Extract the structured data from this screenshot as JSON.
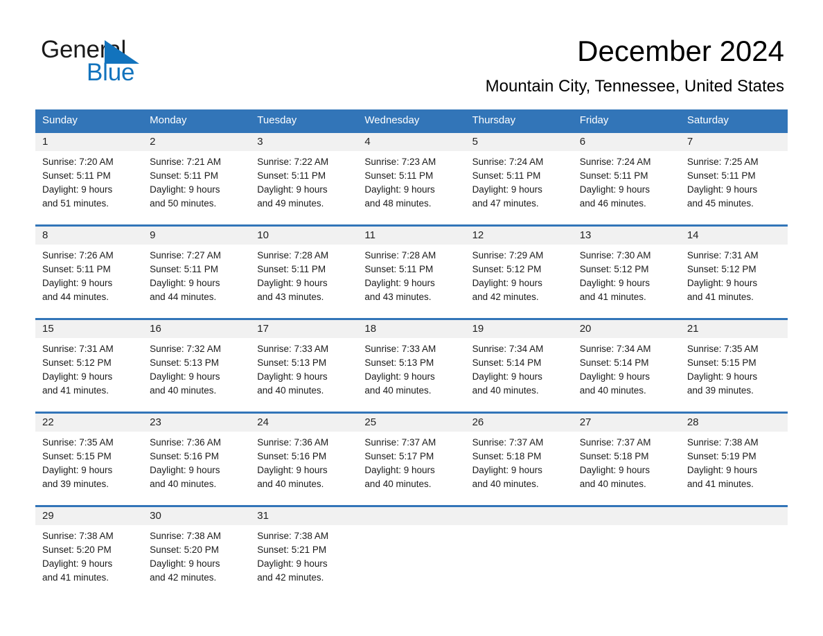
{
  "brand": {
    "name_top": "General",
    "name_bottom": "Blue",
    "accent_color": "#1273bd",
    "header_color": "#3275b8",
    "day_band_color": "#f1f1f1"
  },
  "header": {
    "title": "December 2024",
    "location": "Mountain City, Tennessee, United States"
  },
  "weekdays": [
    "Sunday",
    "Monday",
    "Tuesday",
    "Wednesday",
    "Thursday",
    "Friday",
    "Saturday"
  ],
  "weeks": [
    [
      {
        "day": "1",
        "sunrise": "Sunrise: 7:20 AM",
        "sunset": "Sunset: 5:11 PM",
        "daylight_1": "Daylight: 9 hours",
        "daylight_2": "and 51 minutes."
      },
      {
        "day": "2",
        "sunrise": "Sunrise: 7:21 AM",
        "sunset": "Sunset: 5:11 PM",
        "daylight_1": "Daylight: 9 hours",
        "daylight_2": "and 50 minutes."
      },
      {
        "day": "3",
        "sunrise": "Sunrise: 7:22 AM",
        "sunset": "Sunset: 5:11 PM",
        "daylight_1": "Daylight: 9 hours",
        "daylight_2": "and 49 minutes."
      },
      {
        "day": "4",
        "sunrise": "Sunrise: 7:23 AM",
        "sunset": "Sunset: 5:11 PM",
        "daylight_1": "Daylight: 9 hours",
        "daylight_2": "and 48 minutes."
      },
      {
        "day": "5",
        "sunrise": "Sunrise: 7:24 AM",
        "sunset": "Sunset: 5:11 PM",
        "daylight_1": "Daylight: 9 hours",
        "daylight_2": "and 47 minutes."
      },
      {
        "day": "6",
        "sunrise": "Sunrise: 7:24 AM",
        "sunset": "Sunset: 5:11 PM",
        "daylight_1": "Daylight: 9 hours",
        "daylight_2": "and 46 minutes."
      },
      {
        "day": "7",
        "sunrise": "Sunrise: 7:25 AM",
        "sunset": "Sunset: 5:11 PM",
        "daylight_1": "Daylight: 9 hours",
        "daylight_2": "and 45 minutes."
      }
    ],
    [
      {
        "day": "8",
        "sunrise": "Sunrise: 7:26 AM",
        "sunset": "Sunset: 5:11 PM",
        "daylight_1": "Daylight: 9 hours",
        "daylight_2": "and 44 minutes."
      },
      {
        "day": "9",
        "sunrise": "Sunrise: 7:27 AM",
        "sunset": "Sunset: 5:11 PM",
        "daylight_1": "Daylight: 9 hours",
        "daylight_2": "and 44 minutes."
      },
      {
        "day": "10",
        "sunrise": "Sunrise: 7:28 AM",
        "sunset": "Sunset: 5:11 PM",
        "daylight_1": "Daylight: 9 hours",
        "daylight_2": "and 43 minutes."
      },
      {
        "day": "11",
        "sunrise": "Sunrise: 7:28 AM",
        "sunset": "Sunset: 5:11 PM",
        "daylight_1": "Daylight: 9 hours",
        "daylight_2": "and 43 minutes."
      },
      {
        "day": "12",
        "sunrise": "Sunrise: 7:29 AM",
        "sunset": "Sunset: 5:12 PM",
        "daylight_1": "Daylight: 9 hours",
        "daylight_2": "and 42 minutes."
      },
      {
        "day": "13",
        "sunrise": "Sunrise: 7:30 AM",
        "sunset": "Sunset: 5:12 PM",
        "daylight_1": "Daylight: 9 hours",
        "daylight_2": "and 41 minutes."
      },
      {
        "day": "14",
        "sunrise": "Sunrise: 7:31 AM",
        "sunset": "Sunset: 5:12 PM",
        "daylight_1": "Daylight: 9 hours",
        "daylight_2": "and 41 minutes."
      }
    ],
    [
      {
        "day": "15",
        "sunrise": "Sunrise: 7:31 AM",
        "sunset": "Sunset: 5:12 PM",
        "daylight_1": "Daylight: 9 hours",
        "daylight_2": "and 41 minutes."
      },
      {
        "day": "16",
        "sunrise": "Sunrise: 7:32 AM",
        "sunset": "Sunset: 5:13 PM",
        "daylight_1": "Daylight: 9 hours",
        "daylight_2": "and 40 minutes."
      },
      {
        "day": "17",
        "sunrise": "Sunrise: 7:33 AM",
        "sunset": "Sunset: 5:13 PM",
        "daylight_1": "Daylight: 9 hours",
        "daylight_2": "and 40 minutes."
      },
      {
        "day": "18",
        "sunrise": "Sunrise: 7:33 AM",
        "sunset": "Sunset: 5:13 PM",
        "daylight_1": "Daylight: 9 hours",
        "daylight_2": "and 40 minutes."
      },
      {
        "day": "19",
        "sunrise": "Sunrise: 7:34 AM",
        "sunset": "Sunset: 5:14 PM",
        "daylight_1": "Daylight: 9 hours",
        "daylight_2": "and 40 minutes."
      },
      {
        "day": "20",
        "sunrise": "Sunrise: 7:34 AM",
        "sunset": "Sunset: 5:14 PM",
        "daylight_1": "Daylight: 9 hours",
        "daylight_2": "and 40 minutes."
      },
      {
        "day": "21",
        "sunrise": "Sunrise: 7:35 AM",
        "sunset": "Sunset: 5:15 PM",
        "daylight_1": "Daylight: 9 hours",
        "daylight_2": "and 39 minutes."
      }
    ],
    [
      {
        "day": "22",
        "sunrise": "Sunrise: 7:35 AM",
        "sunset": "Sunset: 5:15 PM",
        "daylight_1": "Daylight: 9 hours",
        "daylight_2": "and 39 minutes."
      },
      {
        "day": "23",
        "sunrise": "Sunrise: 7:36 AM",
        "sunset": "Sunset: 5:16 PM",
        "daylight_1": "Daylight: 9 hours",
        "daylight_2": "and 40 minutes."
      },
      {
        "day": "24",
        "sunrise": "Sunrise: 7:36 AM",
        "sunset": "Sunset: 5:16 PM",
        "daylight_1": "Daylight: 9 hours",
        "daylight_2": "and 40 minutes."
      },
      {
        "day": "25",
        "sunrise": "Sunrise: 7:37 AM",
        "sunset": "Sunset: 5:17 PM",
        "daylight_1": "Daylight: 9 hours",
        "daylight_2": "and 40 minutes."
      },
      {
        "day": "26",
        "sunrise": "Sunrise: 7:37 AM",
        "sunset": "Sunset: 5:18 PM",
        "daylight_1": "Daylight: 9 hours",
        "daylight_2": "and 40 minutes."
      },
      {
        "day": "27",
        "sunrise": "Sunrise: 7:37 AM",
        "sunset": "Sunset: 5:18 PM",
        "daylight_1": "Daylight: 9 hours",
        "daylight_2": "and 40 minutes."
      },
      {
        "day": "28",
        "sunrise": "Sunrise: 7:38 AM",
        "sunset": "Sunset: 5:19 PM",
        "daylight_1": "Daylight: 9 hours",
        "daylight_2": "and 41 minutes."
      }
    ],
    [
      {
        "day": "29",
        "sunrise": "Sunrise: 7:38 AM",
        "sunset": "Sunset: 5:20 PM",
        "daylight_1": "Daylight: 9 hours",
        "daylight_2": "and 41 minutes."
      },
      {
        "day": "30",
        "sunrise": "Sunrise: 7:38 AM",
        "sunset": "Sunset: 5:20 PM",
        "daylight_1": "Daylight: 9 hours",
        "daylight_2": "and 42 minutes."
      },
      {
        "day": "31",
        "sunrise": "Sunrise: 7:38 AM",
        "sunset": "Sunset: 5:21 PM",
        "daylight_1": "Daylight: 9 hours",
        "daylight_2": "and 42 minutes."
      },
      {
        "day": "",
        "sunrise": "",
        "sunset": "",
        "daylight_1": "",
        "daylight_2": ""
      },
      {
        "day": "",
        "sunrise": "",
        "sunset": "",
        "daylight_1": "",
        "daylight_2": ""
      },
      {
        "day": "",
        "sunrise": "",
        "sunset": "",
        "daylight_1": "",
        "daylight_2": ""
      },
      {
        "day": "",
        "sunrise": "",
        "sunset": "",
        "daylight_1": "",
        "daylight_2": ""
      }
    ]
  ]
}
